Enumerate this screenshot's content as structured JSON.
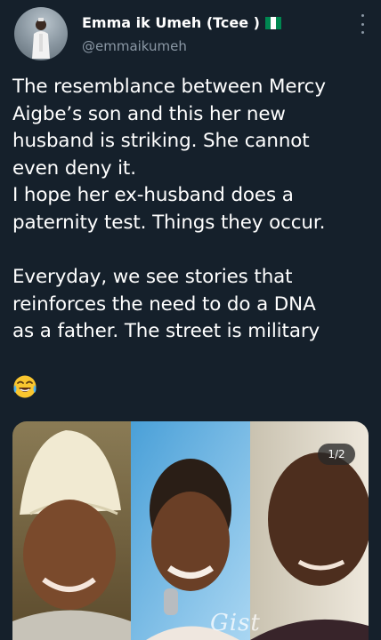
{
  "author": {
    "name": "Emma ik Umeh (Tcee )",
    "handle": "@emmaikumeh",
    "verified_flag_colors": [
      "#008751",
      "#ffffff",
      "#008751"
    ]
  },
  "menu_icon": "more-vertical-icon",
  "tweet": {
    "text": "The resemblance between Mercy\nAigbe’s son and this her new\nhusband is striking. She cannot\neven deny it.\nI hope her ex-husband does a\npaternity test. Things they occur.\n\nEveryday, we see stories that\nreinforces the need to do a DNA\nas a father. The street is military",
    "emoji": "face-with-tears-of-joy"
  },
  "media": {
    "counter": "1/2",
    "watermark": "Gist"
  },
  "colors": {
    "background": "#15202b",
    "secondary_text": "#8b98a5",
    "primary_text": "#ffffff"
  }
}
